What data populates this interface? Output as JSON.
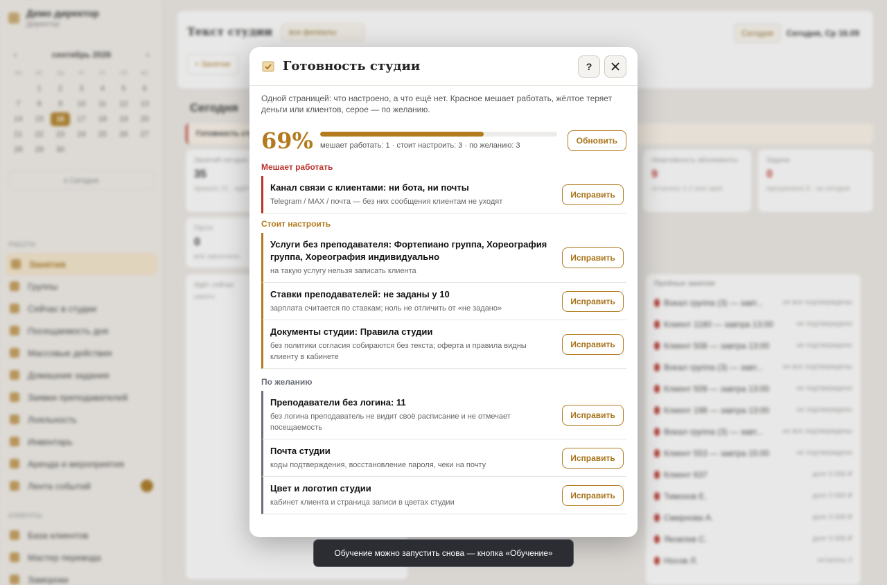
{
  "background": {
    "user": {
      "name": "Демо директор",
      "role": "Директор"
    },
    "calendar": {
      "month": "сентябрь 2026",
      "weekdays": [
        "пн",
        "вт",
        "ср",
        "чт",
        "пт",
        "сб",
        "вс"
      ],
      "days": [
        "",
        "1",
        "2",
        "3",
        "4",
        "5",
        "6",
        "7",
        "8",
        "9",
        "10",
        "11",
        "12",
        "13",
        "14",
        "15",
        "16",
        "17",
        "18",
        "19",
        "20",
        "21",
        "22",
        "23",
        "24",
        "25",
        "26",
        "27",
        "28",
        "29",
        "30"
      ],
      "today": "16",
      "today_button": "к Сегодня"
    },
    "section_work": "Работа",
    "menu": [
      "Занятия",
      "Группы",
      "Сейчас в студии",
      "Посещаемость дня",
      "Массовые действия",
      "Домашние задания",
      "Заявки преподавателей",
      "Лояльность",
      "Инвентарь",
      "Аренда и мероприятия",
      "Лента событий"
    ],
    "section_clients": "Клиенты",
    "menu2": [
      "База клиентов",
      "Мастер перевода",
      "Замороки"
    ],
    "topbar": {
      "title": "Текст студии",
      "filter": "все филиалы",
      "btn": "Сегодня",
      "date": "Сегодня, Ср 16.09",
      "new": "+ Занятие"
    },
    "content_title": "Сегодня",
    "warn": "Готовность студии",
    "stats": [
      {
        "label": "Занятий сегодня",
        "value": "35",
        "sub": "прошло 21 · идёт"
      },
      {
        "label": "Неактивность абонементы",
        "value": "9",
        "sub": "осталось 1-2 или срок"
      },
      {
        "label": "Задачи",
        "value": "0",
        "sub": "просрочено 0 · за сегодня"
      },
      {
        "label": "Пусто",
        "value": "0",
        "sub": "всё закончено"
      }
    ],
    "panel_left": {
      "title": "Идёт сейчас",
      "sub": "никого"
    },
    "panel_right": {
      "title": "Пробные занятия",
      "rows": [
        {
          "name": "Вокал группа (3) — завт...",
          "status": "не все подтверждены"
        },
        {
          "name": "Клиент 1180 — завтра 13:00",
          "status": "не подтверждено"
        },
        {
          "name": "Клиент 508 — завтра 13:00",
          "status": "не подтверждено"
        },
        {
          "name": "Вокал группа (3) — завт...",
          "status": "не все подтверждены"
        },
        {
          "name": "Клиент 509 — завтра 13:00",
          "status": "не подтверждено"
        },
        {
          "name": "Клиент 198 — завтра 13:00",
          "status": "не подтверждено"
        },
        {
          "name": "Вокал группа (3) — завт...",
          "status": "не все подтверждены"
        },
        {
          "name": "Клиент 553 — завтра 15:00",
          "status": "не подтверждено"
        },
        {
          "name": "Клиент 637",
          "status": "долг 0 000 ₽"
        },
        {
          "name": "Тимохов Е.",
          "status": "долг 0 000 ₽"
        },
        {
          "name": "Смирнова А.",
          "status": "долг 0 000 ₽"
        },
        {
          "name": "Яковлев С.",
          "status": "долг 0 000 ₽"
        },
        {
          "name": "Носов Л.",
          "status": "осталось 2"
        }
      ]
    }
  },
  "modal": {
    "title": "Готовность студии",
    "help_label": "?",
    "intro": "Одной страницей: что настроено, а что ещё нет. Красное мешает работать, жёлтое теряет деньги или клиентов, серое — по желанию.",
    "percent_text": "69%",
    "percent": 69,
    "summary": "мешает работать: 1 · стоит настроить: 3 · по желанию: 3",
    "refresh_label": "Обновить",
    "fix_label": "Исправить",
    "sections": {
      "blocking": {
        "title": "Мешает работать",
        "items": [
          {
            "title": "Канал связи с клиентами: ни бота, ни почты",
            "desc": "Telegram / MAX / почта — без них сообщения клиентам не уходят"
          }
        ]
      },
      "recommended": {
        "title": "Стоит настроить",
        "items": [
          {
            "title": "Услуги без преподавателя: Фортепиано группа, Хореография группа, Хореография индивидуально",
            "desc": "на такую услугу нельзя записать клиента"
          },
          {
            "title": "Ставки преподавателей: не заданы у 10",
            "desc": "зарплата считается по ставкам; ноль не отличить от «не задано»"
          },
          {
            "title": "Документы студии: Правила студии",
            "desc": "без политики согласия собираются без текста; оферта и правила видны клиенту в кабинете"
          }
        ]
      },
      "optional": {
        "title": "По желанию",
        "items": [
          {
            "title": "Преподаватели без логина: 11",
            "desc": "без логина преподаватель не видит своё расписание и не отмечает посещаемость"
          },
          {
            "title": "Почта студии",
            "desc": "коды подтверждения, восстановление пароля, чеки на почту"
          },
          {
            "title": "Цвет и логотип студии",
            "desc": "кабинет клиента и страница записи в цветах студии"
          }
        ]
      }
    }
  },
  "toast": "Обучение можно запустить снова — кнопка «Обучение»",
  "colors": {
    "accent": "#b37a1e",
    "danger": "#b8322b",
    "muted": "#6b6e78"
  }
}
